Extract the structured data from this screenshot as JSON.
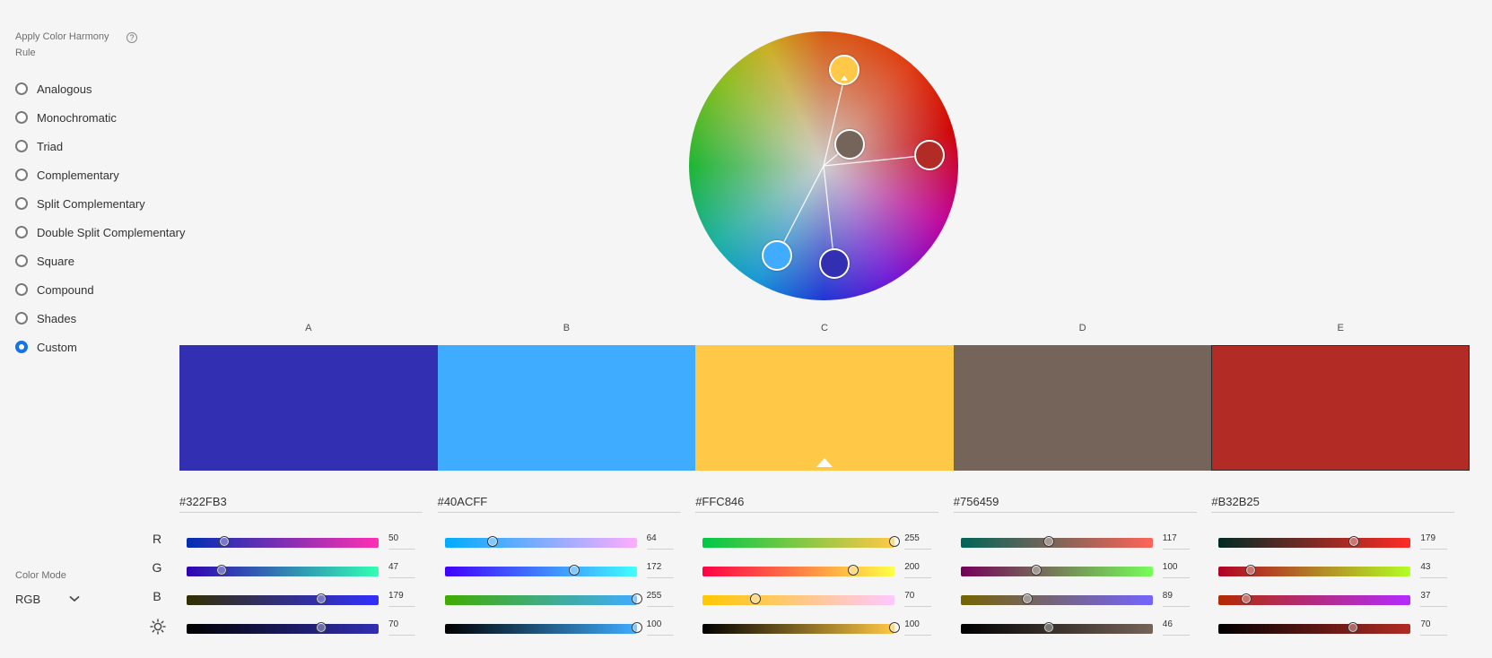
{
  "left_panel": {
    "title": "Apply Color Harmony Rule",
    "help_icon": "?",
    "rules": [
      {
        "label": "Analogous",
        "selected": false
      },
      {
        "label": "Monochromatic",
        "selected": false
      },
      {
        "label": "Triad",
        "selected": false
      },
      {
        "label": "Complementary",
        "selected": false
      },
      {
        "label": "Split Complementary",
        "selected": false
      },
      {
        "label": "Double Split Complementary",
        "selected": false
      },
      {
        "label": "Square",
        "selected": false
      },
      {
        "label": "Compound",
        "selected": false
      },
      {
        "label": "Shades",
        "selected": false
      },
      {
        "label": "Custom",
        "selected": true
      }
    ],
    "color_mode": {
      "label": "Color Mode",
      "value": "RGB"
    }
  },
  "channels": [
    "R",
    "G",
    "B"
  ],
  "brightness_icon": "sun-icon",
  "palette": [
    {
      "id": "A",
      "hex": "#322FB3",
      "color": "#322FB3",
      "r": 50,
      "g": 47,
      "b": 179,
      "brightness": 70
    },
    {
      "id": "B",
      "hex": "#40ACFF",
      "color": "#40ACFF",
      "r": 64,
      "g": 172,
      "b": 255,
      "brightness": 100
    },
    {
      "id": "C",
      "hex": "#FFC846",
      "color": "#FFC846",
      "r": 255,
      "g": 200,
      "b": 70,
      "brightness": 100,
      "active": true
    },
    {
      "id": "D",
      "hex": "#756459",
      "color": "#756459",
      "r": 117,
      "g": 100,
      "b": 89,
      "brightness": 46
    },
    {
      "id": "E",
      "hex": "#B32B25",
      "color": "#B32B25",
      "r": 179,
      "g": 43,
      "b": 37,
      "brightness": 70,
      "outlined": true
    }
  ]
}
